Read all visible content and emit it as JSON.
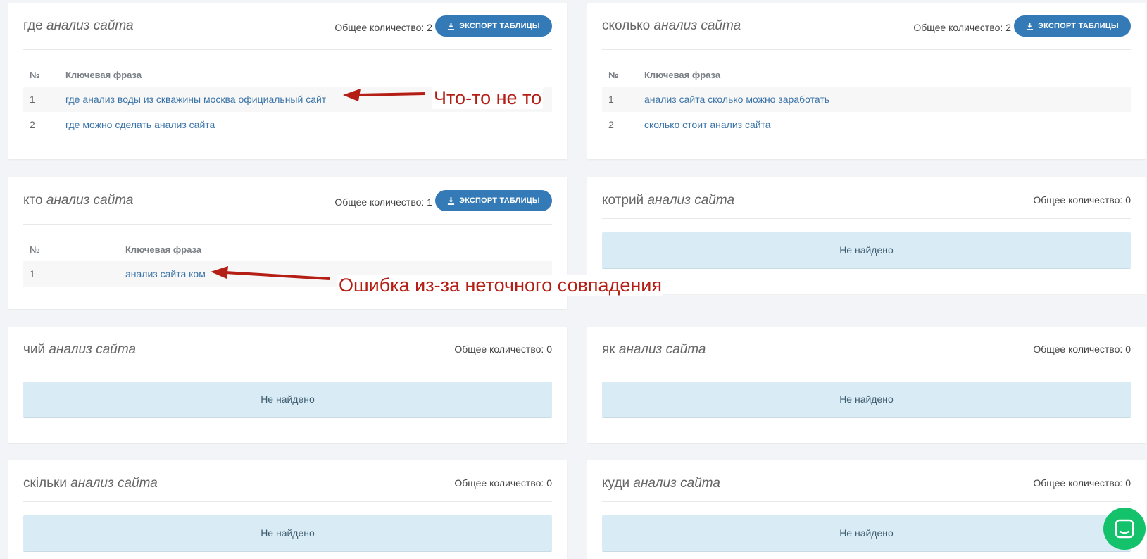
{
  "count_label": "Общее количество:",
  "export_label": "ЭКСПОРТ ТАБЛИЦЫ",
  "not_found": "Не найдено",
  "columns": {
    "num": "№",
    "phrase": "Ключевая фраза"
  },
  "panels": [
    {
      "prefix": "где",
      "suffix": "анализ сайта",
      "count": "2",
      "rows": [
        {
          "num": "1",
          "phrase": "где анализ воды из скважины москва официальный сайт"
        },
        {
          "num": "2",
          "phrase": "где можно сделать анализ сайта"
        }
      ]
    },
    {
      "prefix": "сколько",
      "suffix": "анализ сайта",
      "count": "2",
      "rows": [
        {
          "num": "1",
          "phrase": "анализ сайта сколько можно заработать"
        },
        {
          "num": "2",
          "phrase": "сколько стоит анализ сайта"
        }
      ]
    },
    {
      "prefix": "кто",
      "suffix": "анализ сайта",
      "count": "1",
      "rows": [
        {
          "num": "1",
          "phrase": "анализ сайта ком"
        }
      ]
    },
    {
      "prefix": "котрий",
      "suffix": "анализ сайта",
      "count": "0"
    },
    {
      "prefix": "чий",
      "suffix": "анализ сайта",
      "count": "0"
    },
    {
      "prefix": "як",
      "suffix": "анализ сайта",
      "count": "0"
    },
    {
      "prefix": "скільки",
      "suffix": "анализ сайта",
      "count": "0"
    },
    {
      "prefix": "куди",
      "suffix": "анализ сайта",
      "count": "0"
    }
  ],
  "annotations": {
    "wrong": "Что-то не то",
    "mismatch": "Ошибка из-за неточного совпадения"
  },
  "colors": {
    "accent": "#337ab7",
    "annotation": "#b41e14",
    "chat": "#13c26b"
  },
  "icons": {
    "export": "download-icon",
    "chat": "chat-icon"
  }
}
